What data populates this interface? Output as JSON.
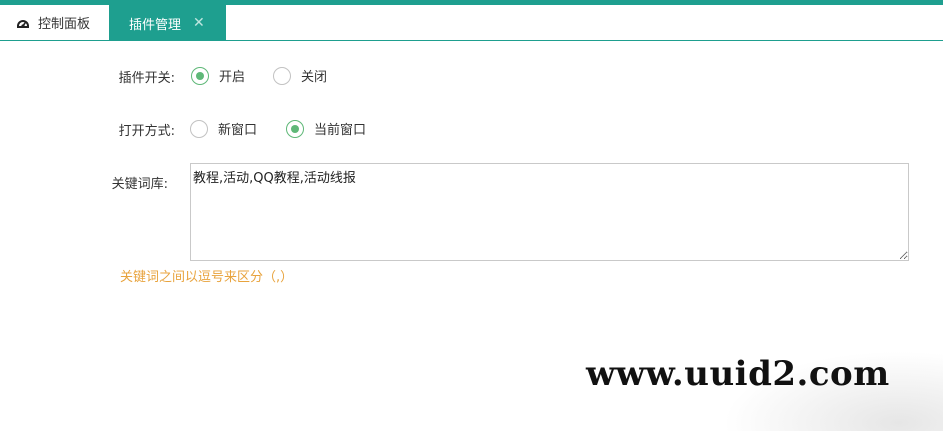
{
  "tabs": [
    {
      "label": "控制面板",
      "icon": "dashboard-icon",
      "active": false
    },
    {
      "label": "插件管理",
      "active": true,
      "close_icon": "close-icon",
      "close_glyph": "✕"
    }
  ],
  "colors": {
    "accent": "#1e9f8f",
    "radio_checked": "#5fb878",
    "hint": "#e8a33d"
  },
  "form": {
    "plugin_switch": {
      "label": "插件开关:",
      "options": [
        {
          "label": "开启",
          "checked": true
        },
        {
          "label": "关闭",
          "checked": false
        }
      ]
    },
    "open_mode": {
      "label": "打开方式:",
      "options": [
        {
          "label": "新窗口",
          "checked": false
        },
        {
          "label": "当前窗口",
          "checked": true
        }
      ]
    },
    "keywords": {
      "label": "关键词库:",
      "value": "教程,活动,QQ教程,活动线报",
      "hint": "关键词之间以逗号来区分（,）"
    }
  },
  "watermark": "www.uuid2.com"
}
